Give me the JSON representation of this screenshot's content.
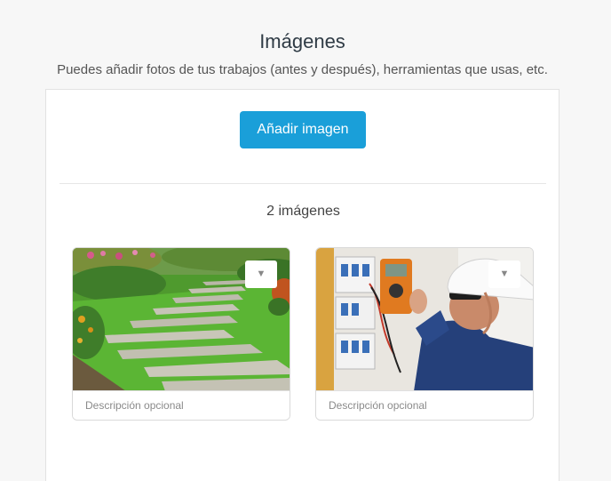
{
  "header": {
    "title": "Imágenes",
    "subtitle": "Puedes añadir fotos de tus trabajos (antes y después), herramientas que usas, etc."
  },
  "uploader": {
    "add_button_label": "Añadir imagen",
    "count_label": "2 imágenes"
  },
  "images": [
    {
      "subject": "garden stepping-stone path",
      "menu_icon": "▼",
      "description_placeholder": "Descripción opcional"
    },
    {
      "subject": "electrician measuring with multimeter",
      "menu_icon": "▼",
      "description_placeholder": "Descripción opcional"
    }
  ],
  "colors": {
    "accent": "#1a9fd9",
    "background": "#f7f7f7"
  }
}
